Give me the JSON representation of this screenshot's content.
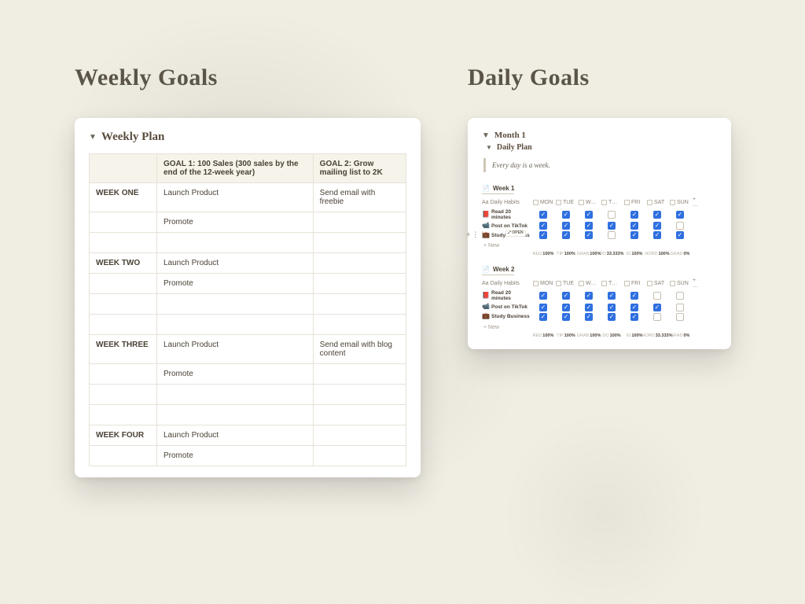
{
  "left": {
    "heading": "Weekly Goals",
    "card_title": "Weekly Plan",
    "col_week": "",
    "goal1": "GOAL 1: 100 Sales (300 sales by the end of the 12-week year)",
    "goal2": "GOAL 2: Grow mailing list to 2K",
    "weeks": [
      {
        "name": "WEEK ONE",
        "rows": [
          {
            "g1": "Launch Product",
            "g2": "Send email with freebie"
          },
          {
            "g1": "Promote",
            "g2": ""
          },
          {
            "g1": "",
            "g2": ""
          }
        ]
      },
      {
        "name": "WEEK TWO",
        "rows": [
          {
            "g1": "Launch Product",
            "g2": ""
          },
          {
            "g1": "Promote",
            "g2": ""
          },
          {
            "g1": "",
            "g2": ""
          },
          {
            "g1": "",
            "g2": ""
          }
        ]
      },
      {
        "name": "WEEK THREE",
        "rows": [
          {
            "g1": "Launch Product",
            "g2": "Send email with blog content"
          },
          {
            "g1": "Promote",
            "g2": ""
          },
          {
            "g1": "",
            "g2": ""
          },
          {
            "g1": "",
            "g2": ""
          }
        ]
      },
      {
        "name": "WEEK FOUR",
        "rows": [
          {
            "g1": "Launch Product",
            "g2": ""
          },
          {
            "g1": "Promote",
            "g2": ""
          }
        ]
      }
    ]
  },
  "right": {
    "heading": "Daily Goals",
    "month_label": "Month 1",
    "card_title": "Daily Plan",
    "quote": "Every day is a week.",
    "days_header_label": "Daily Habits",
    "days": [
      "MON",
      "TUE",
      "W…",
      "T…",
      "FRI",
      "SAT",
      "SUN"
    ],
    "new_label": "+ New",
    "open_label": "OPEN",
    "weeks": [
      {
        "label": "Week 1",
        "habits": [
          {
            "icon": "📕",
            "name": "Read 20 minutes",
            "checks": [
              true,
              true,
              true,
              false,
              true,
              true,
              true
            ]
          },
          {
            "icon": "📹",
            "name": "Post on TikTok",
            "checks": [
              true,
              true,
              true,
              true,
              true,
              true,
              false
            ]
          },
          {
            "icon": "💼",
            "name": "Study Business",
            "checks": [
              true,
              true,
              true,
              false,
              true,
              true,
              true
            ]
          }
        ],
        "pct": [
          "100%",
          "100%",
          "100%",
          "33.333%",
          "100%",
          "100%",
          "0%"
        ],
        "pct_prefixes": [
          "RED",
          "TIP",
          "GRAB",
          "DO",
          "IG",
          "HORD",
          "GRAD"
        ]
      },
      {
        "label": "Week 2",
        "habits": [
          {
            "icon": "📕",
            "name": "Read 20 minutes",
            "checks": [
              true,
              true,
              true,
              true,
              true,
              false,
              false
            ]
          },
          {
            "icon": "📹",
            "name": "Post on TikTok",
            "checks": [
              true,
              true,
              true,
              true,
              true,
              true,
              false
            ]
          },
          {
            "icon": "💼",
            "name": "Study Business",
            "checks": [
              true,
              true,
              true,
              true,
              true,
              false,
              false
            ]
          }
        ],
        "pct": [
          "100%",
          "100%",
          "100%",
          "100%",
          "100%",
          "33.333%",
          "0%"
        ],
        "pct_prefixes": [
          "RED",
          "TIP",
          "GRAB",
          "DO",
          "IG",
          "HORD",
          "GRAD"
        ]
      }
    ]
  }
}
